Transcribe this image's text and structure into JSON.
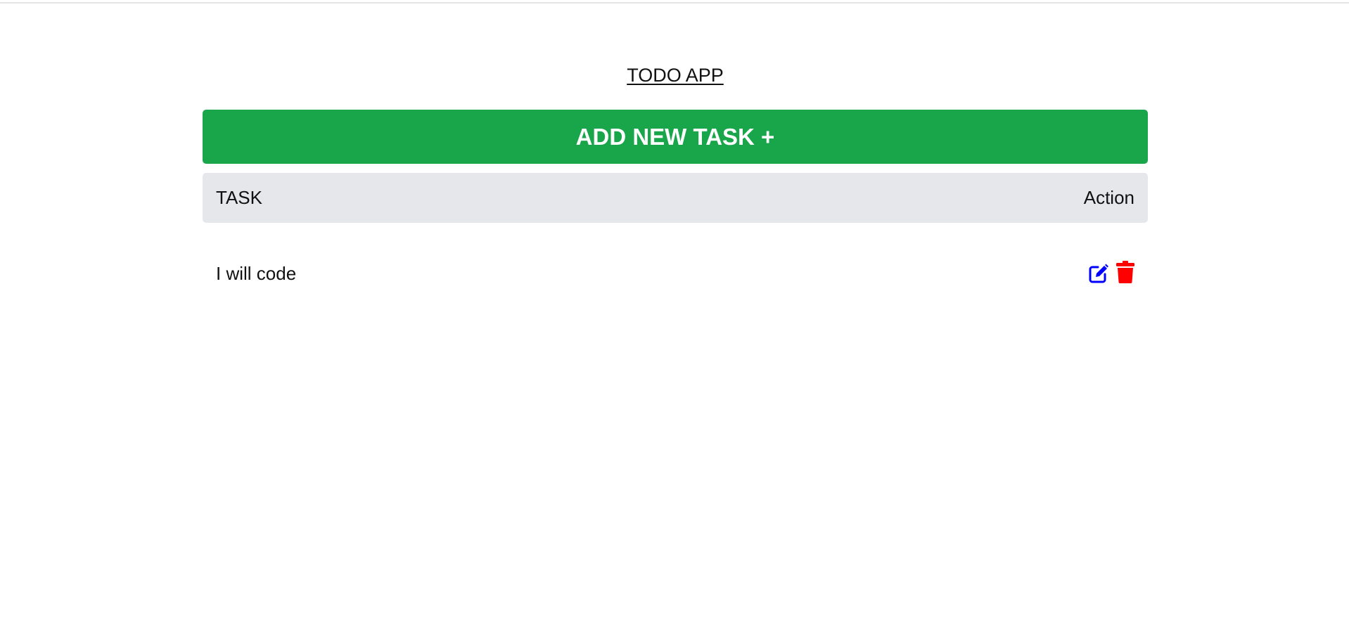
{
  "app": {
    "title": "TODO APP"
  },
  "add_button": {
    "label": "ADD NEW TASK +",
    "color": "#19a64b"
  },
  "table": {
    "headers": {
      "task": "TASK",
      "action": "Action"
    },
    "rows": [
      {
        "task": "I will code",
        "actions": [
          {
            "icon": "edit-icon",
            "color": "#0000ff"
          },
          {
            "icon": "trash-icon",
            "color": "#ff0000"
          }
        ]
      }
    ]
  }
}
